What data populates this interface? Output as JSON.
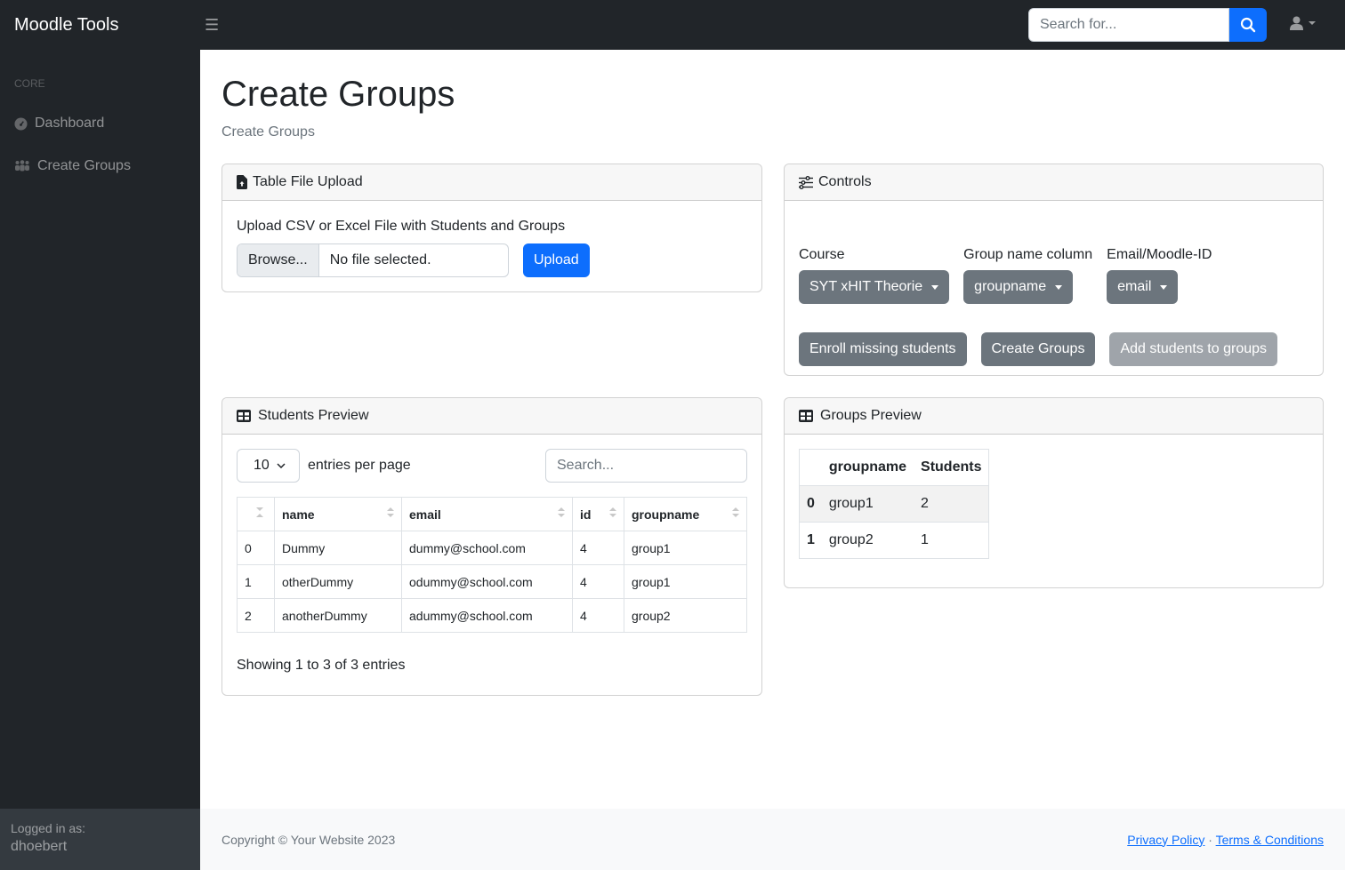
{
  "app": {
    "brand": "Moodle Tools"
  },
  "topnav": {
    "search_placeholder": "Search for...",
    "search_value": "",
    "icons": {
      "toggle": "hamburger-icon",
      "search": "search-icon",
      "user": "user-icon"
    }
  },
  "sidebar": {
    "heading": "Core",
    "items": [
      {
        "label": "Dashboard",
        "icon": "tachometer-icon"
      },
      {
        "label": "Create Groups",
        "icon": "users-icon"
      }
    ],
    "footer": {
      "logged_in_label": "Logged in as:",
      "username": "dhoebert"
    }
  },
  "page": {
    "title": "Create Groups",
    "breadcrumb": "Create Groups"
  },
  "upload_card": {
    "title": "Table File Upload",
    "icon": "file-upload-icon",
    "instruction": "Upload CSV or Excel File with Students and Groups",
    "browse_label": "Browse...",
    "file_status": "No file selected.",
    "upload_label": "Upload"
  },
  "controls_card": {
    "title": "Controls",
    "icon": "sliders-icon",
    "fields": [
      {
        "label": "Course",
        "value": "SYT xHIT Theorie"
      },
      {
        "label": "Group name column",
        "value": "groupname"
      },
      {
        "label": "Email/Moodle-ID",
        "value": "email"
      }
    ],
    "actions": [
      {
        "label": "Enroll missing students",
        "disabled": false
      },
      {
        "label": "Create Groups",
        "disabled": false
      },
      {
        "label": "Add students to groups",
        "disabled": true
      }
    ]
  },
  "students_card": {
    "title": "Students Preview",
    "icon": "table-icon",
    "per_page_value": "10",
    "per_page_label": "entries per page",
    "search_placeholder": "Search...",
    "columns": [
      "",
      "name",
      "email",
      "id",
      "groupname"
    ],
    "rows": [
      [
        "0",
        "Dummy",
        "dummy@school.com",
        "4",
        "group1"
      ],
      [
        "1",
        "otherDummy",
        "odummy@school.com",
        "4",
        "group1"
      ],
      [
        "2",
        "anotherDummy",
        "adummy@school.com",
        "4",
        "group2"
      ]
    ],
    "info": "Showing 1 to 3 of 3 entries"
  },
  "groups_card": {
    "title": "Groups Preview",
    "icon": "table-icon",
    "columns": [
      "",
      "groupname",
      "Students"
    ],
    "rows": [
      [
        "0",
        "group1",
        "2"
      ],
      [
        "1",
        "group2",
        "1"
      ]
    ]
  },
  "footer": {
    "copyright": "Copyright © Your Website 2023",
    "links": [
      "Privacy Policy",
      "Terms & Conditions"
    ],
    "separator": "·"
  },
  "colors": {
    "primary": "#0d6efd",
    "secondary": "#6c757d",
    "dark": "#212529"
  }
}
